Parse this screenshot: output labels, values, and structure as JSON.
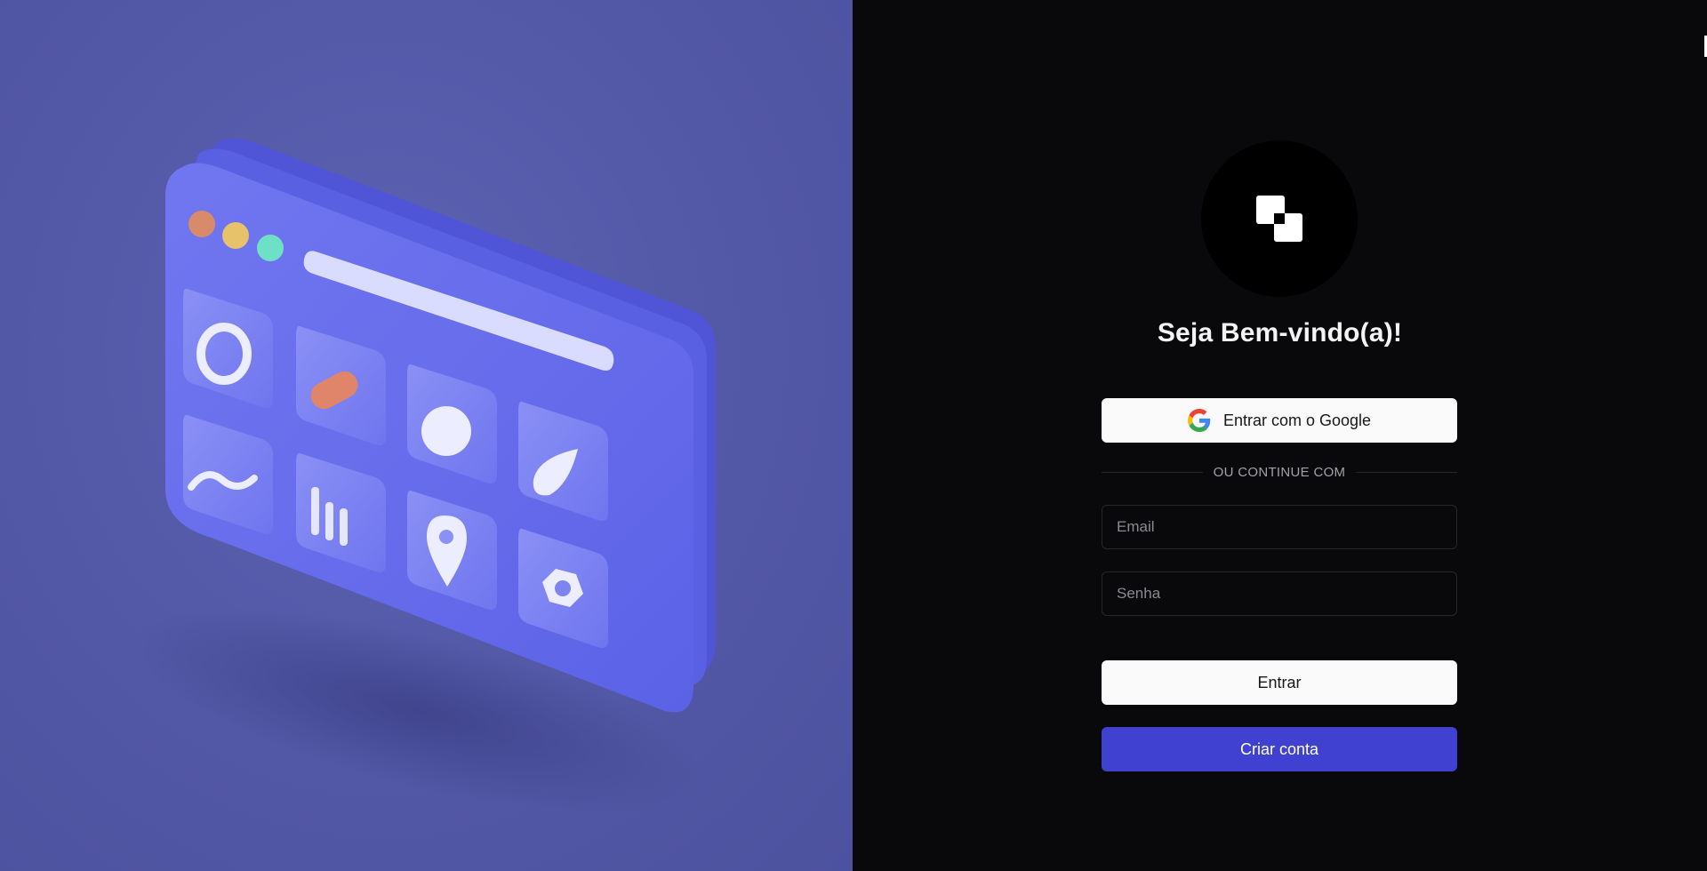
{
  "illustration": {
    "name": "3d-dashboard-illustration",
    "colors": {
      "background": "#5459a8",
      "card": "#6a70ec",
      "tile": "#7a80f2",
      "dot_red": "#d98a6a",
      "dot_yellow": "#e8c26a",
      "dot_green": "#6ee0c8"
    }
  },
  "login": {
    "logo_icon": "overlapping-squares-icon",
    "title": "Seja Bem-vindo(a)!",
    "google_button": "Entrar com o Google",
    "divider_text": "OU CONTINUE COM",
    "email_placeholder": "Email",
    "password_placeholder": "Senha",
    "submit_button": "Entrar",
    "signup_button": "Criar conta"
  },
  "colors": {
    "panel_background": "#09090b",
    "primary_button": "#fafafa",
    "accent_button": "#4041d1",
    "border": "#27272a"
  }
}
